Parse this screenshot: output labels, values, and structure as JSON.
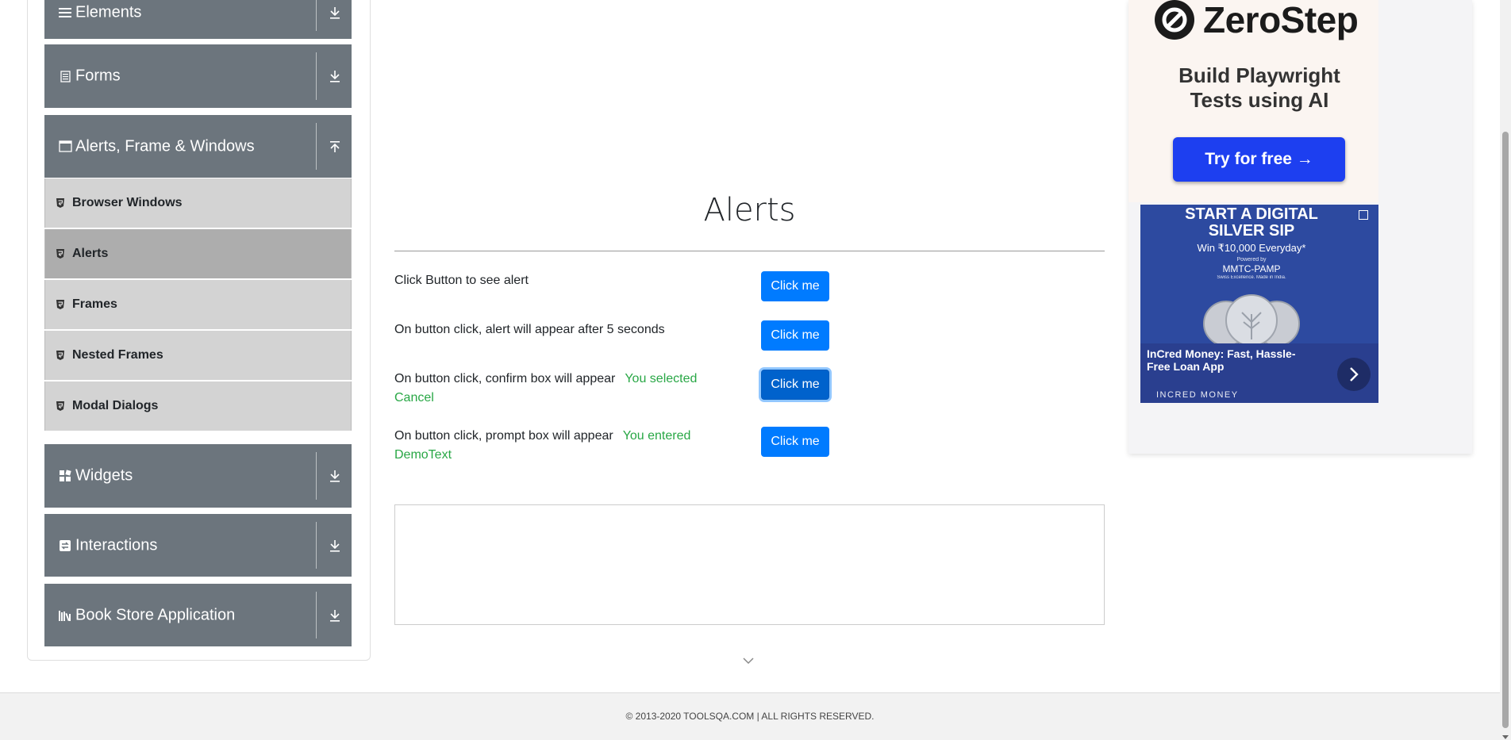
{
  "sidebar": {
    "groups": [
      {
        "label": "Elements",
        "icon": "hamburger-icon",
        "expanded": false
      },
      {
        "label": "Forms",
        "icon": "document-icon",
        "expanded": false
      },
      {
        "label": "Alerts, Frame & Windows",
        "icon": "window-icon",
        "expanded": true
      },
      {
        "label": "Widgets",
        "icon": "widgets-grid-icon",
        "expanded": false
      },
      {
        "label": "Interactions",
        "icon": "interactions-icon",
        "expanded": false
      },
      {
        "label": "Book Store Application",
        "icon": "books-icon",
        "expanded": false
      }
    ],
    "items": [
      {
        "label": "Browser Windows",
        "active": false
      },
      {
        "label": "Alerts",
        "active": true
      },
      {
        "label": "Frames",
        "active": false
      },
      {
        "label": "Nested Frames",
        "active": false
      },
      {
        "label": "Modal Dialogs",
        "active": false
      }
    ]
  },
  "main": {
    "title": "Alerts",
    "rows": [
      {
        "text": "Click Button to see alert",
        "result": "",
        "button": "Click me"
      },
      {
        "text": "On button click, alert will appear after 5 seconds",
        "result": "",
        "button": "Click me"
      },
      {
        "text": "On button click, confirm box will appear",
        "result": "You selected Cancel",
        "button": "Click me"
      },
      {
        "text": "On button click, prompt box will appear",
        "result": "You entered DemoText",
        "button": "Click me"
      }
    ]
  },
  "ads": {
    "zerostep": {
      "brand": "ZeroStep",
      "tagline_1": "Build Playwright",
      "tagline_2": "Tests using AI",
      "cta": "Try for free →"
    },
    "incred": {
      "title_1": "START A DIGITAL",
      "title_2": "SILVER SIP",
      "subtitle": "Win ₹10,000 Everyday*",
      "powered": "Powered by",
      "partner": "MMTC-PAMP",
      "partner_sub": "Swiss Excellence. Made in India.",
      "headline": "InCred Money: Fast, Hassle-Free Loan App",
      "source": "INCRED MONEY"
    }
  },
  "footer": {
    "text": "© 2013-2020 TOOLSQA.COM | ALL RIGHTS RESERVED."
  },
  "colors": {
    "sidebar_group": "#6c757d",
    "sidebar_item": "#d3d3d3",
    "sidebar_item_active": "#adadad",
    "primary_button": "#007bff",
    "result_text": "#28a745",
    "cta_button": "#1d3ff0"
  }
}
